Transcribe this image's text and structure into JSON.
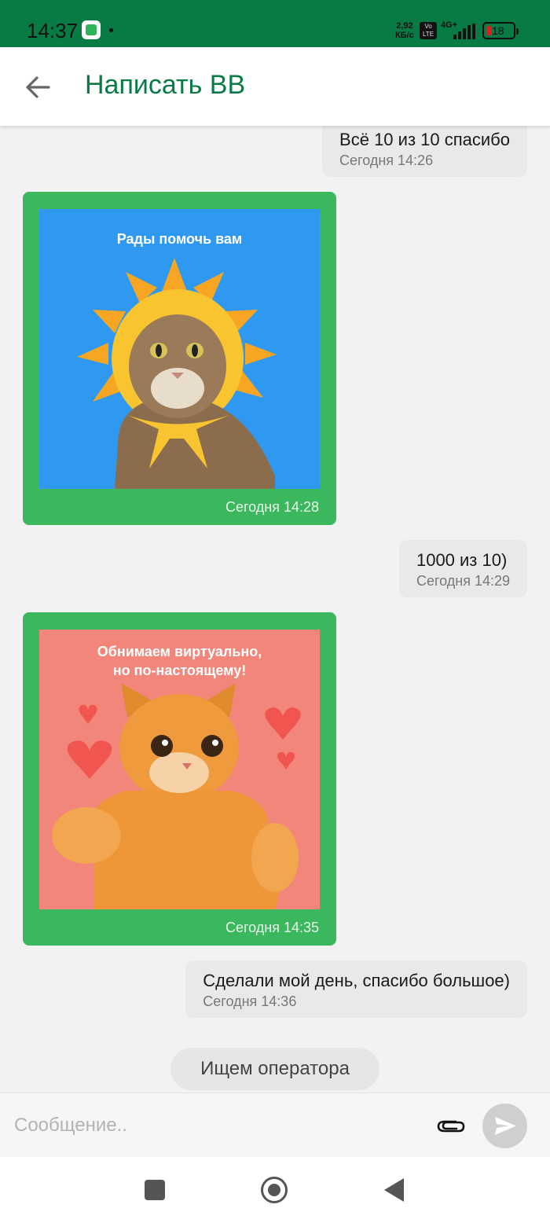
{
  "status_bar": {
    "time": "14:37",
    "net_speed_value": "2,92",
    "net_speed_unit": "КБ/с",
    "volte_line1": "Vo",
    "volte_line2": "LTE",
    "network": "4G+",
    "battery": "18"
  },
  "header": {
    "title": "Написать ВВ"
  },
  "messages": [
    {
      "type": "outgoing-text",
      "text": "Всё 10 из 10 спасибо",
      "time": "Сегодня 14:26"
    },
    {
      "type": "incoming-sticker",
      "caption": "Рады помочь вам",
      "time": "Сегодня 14:28"
    },
    {
      "type": "outgoing-text",
      "text": "1000 из 10)",
      "time": "Сегодня 14:29"
    },
    {
      "type": "incoming-sticker",
      "caption_line1": "Обнимаем виртуально,",
      "caption_line2": "но по-настоящему!",
      "time": "Сегодня 14:35"
    },
    {
      "type": "outgoing-text",
      "text": "Сделали мой день, спасибо большое)",
      "time": "Сегодня 14:36"
    }
  ],
  "operator_status": "Ищем оператора",
  "composer": {
    "placeholder": "Сообщение.."
  },
  "colors": {
    "status_bar": "#087a43",
    "accent_green": "#0a7a46",
    "incoming_bubble": "#3bb85e",
    "outgoing_bubble": "#e9e9e9",
    "sticker1_bg": "#2f98f0",
    "sticker2_bg": "#f2867b"
  },
  "icons": {
    "back": "arrow-left-icon",
    "attach": "paperclip-icon",
    "send": "send-icon"
  }
}
